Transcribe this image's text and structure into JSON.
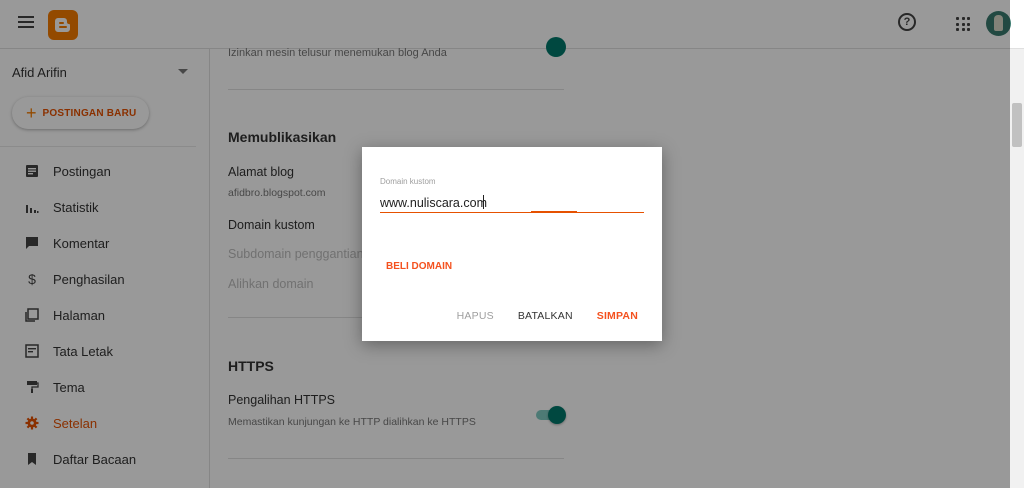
{
  "account": {
    "name": "Afid Arifin"
  },
  "new_post_label": "POSTINGAN BARU",
  "nav": [
    {
      "label": "Postingan",
      "icon": "posts-icon"
    },
    {
      "label": "Statistik",
      "icon": "stats-icon"
    },
    {
      "label": "Komentar",
      "icon": "comment-icon"
    },
    {
      "label": "Penghasilan",
      "icon": "dollar-icon"
    },
    {
      "label": "Halaman",
      "icon": "pages-icon"
    },
    {
      "label": "Tata Letak",
      "icon": "layout-icon"
    },
    {
      "label": "Tema",
      "icon": "paint-roller-icon"
    },
    {
      "label": "Setelan",
      "icon": "gear-icon",
      "active": true
    },
    {
      "label": "Daftar Bacaan",
      "icon": "bookmark-icon"
    }
  ],
  "main": {
    "top_row_text": "Izinkan mesin telusur menemukan blog Anda",
    "publish_title": "Memublikasikan",
    "blog_address_label": "Alamat blog",
    "blog_address_value": "afidbro.blogspot.com",
    "custom_domain_label": "Domain kustom",
    "subdomain_label": "Subdomain penggantian",
    "redirect_label": "Alihkan domain",
    "https_title": "HTTPS",
    "https_redirect_label": "Pengalihan HTTPS",
    "https_redirect_sub": "Memastikan kunjungan ke HTTP dialihkan ke HTTPS"
  },
  "dialog": {
    "field_label": "Domain kustom",
    "field_value": "www.nuliscara.com",
    "buy_domain": "BELI DOMAIN",
    "delete": "HAPUS",
    "cancel": "BATALKAN",
    "save": "SIMPAN"
  },
  "colors": {
    "accent": "#f4511e",
    "brand": "#f57c00",
    "toggle": "#00796b"
  }
}
